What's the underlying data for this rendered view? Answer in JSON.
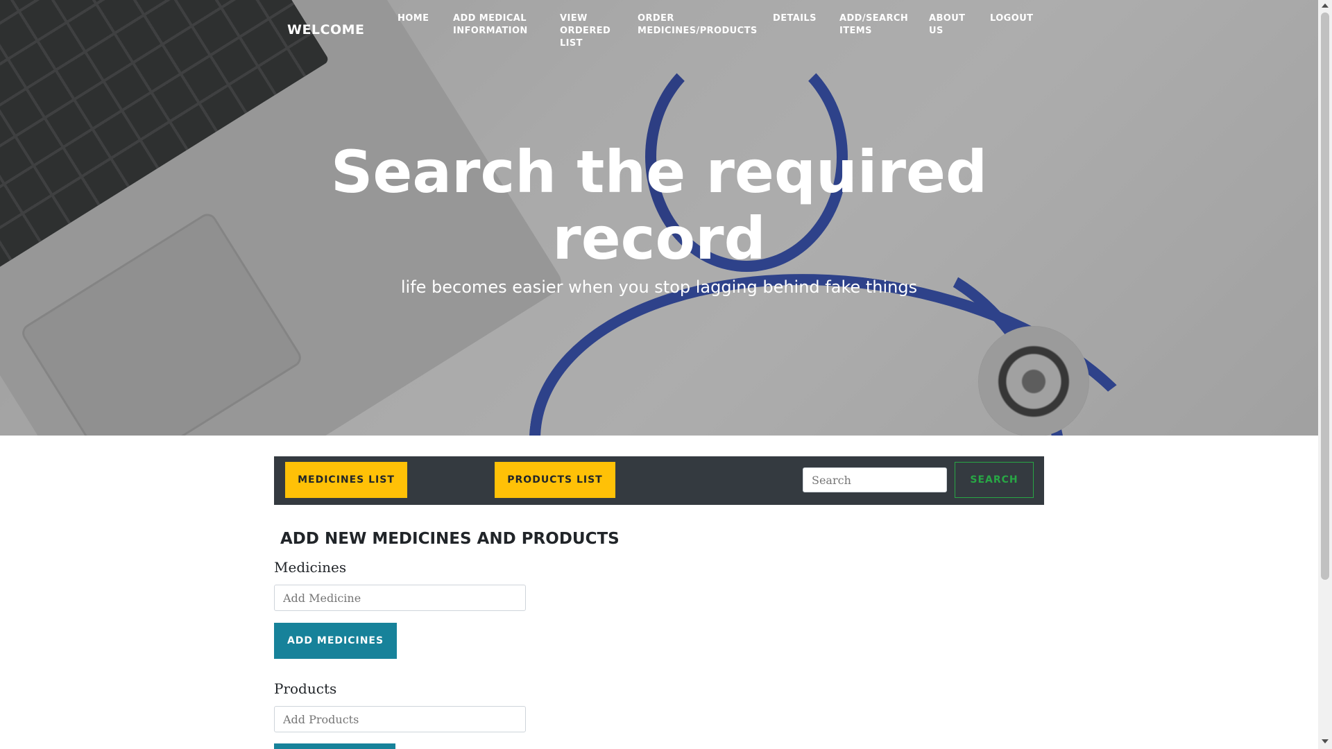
{
  "nav": {
    "brand": "WELCOME",
    "links": [
      {
        "label": "HOME"
      },
      {
        "label": "ADD MEDICAL INFORMATION"
      },
      {
        "label": "VIEW ORDERED LIST"
      },
      {
        "label": "ORDER MEDICINES/PRODUCTS"
      },
      {
        "label": "DETAILS"
      },
      {
        "label": "ADD/SEARCH ITEMS"
      },
      {
        "label": "ABOUT US"
      },
      {
        "label": "LOGOUT"
      }
    ]
  },
  "hero": {
    "title": "Search the required record",
    "subtitle": "life becomes easier when you stop lagging behind fake things"
  },
  "toolbar": {
    "medicines_list_label": "MEDICINES LIST",
    "products_list_label": "PRODUCTS LIST",
    "search_placeholder": "Search",
    "search_button_label": "SEARCH"
  },
  "form": {
    "section_title": "ADD NEW MEDICINES AND PRODUCTS",
    "medicines_label": "Medicines",
    "medicines_placeholder": "Add Medicine",
    "add_medicines_button": "ADD MEDICINES",
    "products_label": "Products",
    "products_placeholder": "Add Products"
  },
  "colors": {
    "toolbar_bg": "#343a40",
    "yellow_button": "#ffc107",
    "search_green": "#28a745",
    "teal_button": "#17829a",
    "stethoscope_blue": "#1f3fb4"
  }
}
